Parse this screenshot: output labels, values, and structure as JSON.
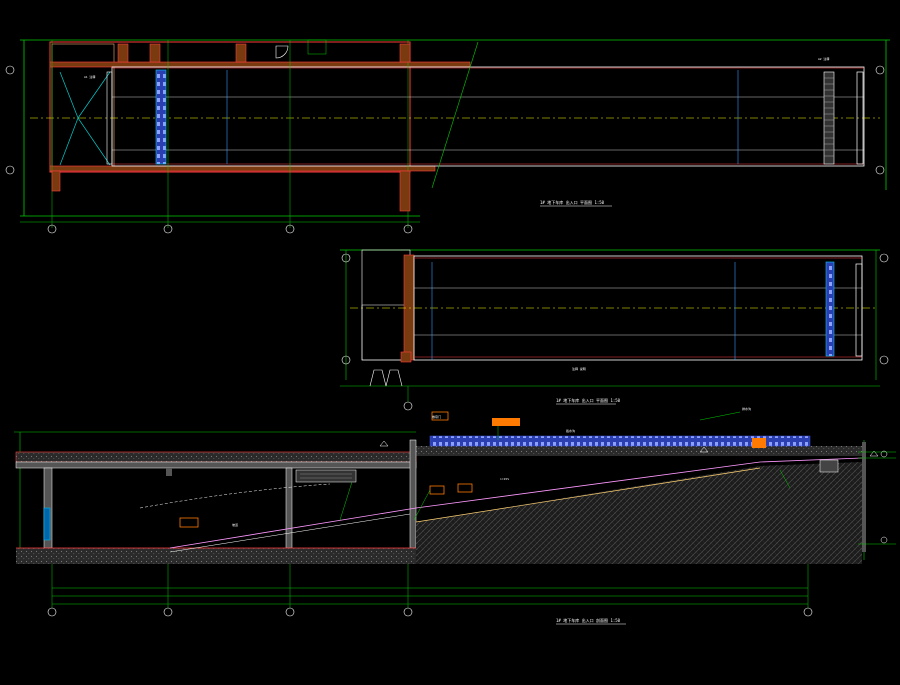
{
  "colors": {
    "background": "#000000",
    "wall": "#ff3c3c",
    "axis": "#ffff00",
    "dimension": "#00cc00",
    "detail": "#ffffff",
    "gutter": "#3a55d6",
    "note_box": "#ff7a00",
    "grid_marker": "#00ff66"
  },
  "views": [
    {
      "id": "plan-upper",
      "caption": "1# 地下车库 出入口 平面图 1:50"
    },
    {
      "id": "plan-lower",
      "caption": "1# 地下车库 出入口 平面图 1:50"
    },
    {
      "id": "section",
      "caption": "1# 地下车库 出入口 剖面图 1:50"
    }
  ],
  "annotations": {
    "gate_sign": "卷帘门",
    "drain_note": "截水沟",
    "slope_note": "i=15%",
    "ramp_note": "坡道",
    "top_right_note": "排水沟"
  },
  "icons": [
    "grid-bubble-icon",
    "elevation-marker-icon",
    "door-swing-icon"
  ]
}
